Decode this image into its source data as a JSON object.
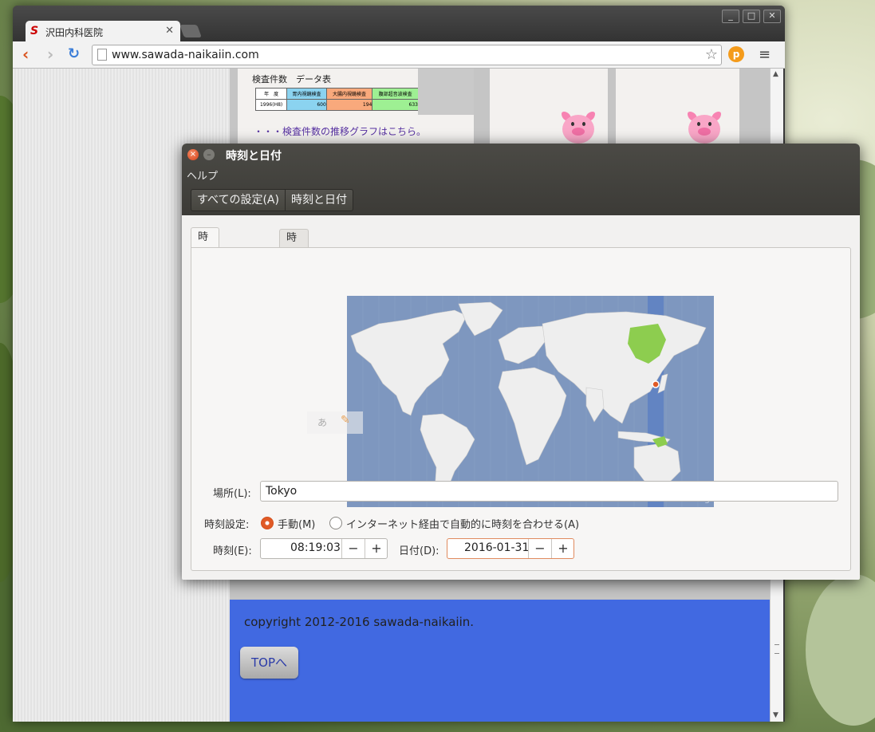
{
  "browser": {
    "tab_title": "沢田内科医院",
    "url": "www.sawada-naikaiin.com",
    "window_controls": [
      "minimize",
      "maximize",
      "close"
    ]
  },
  "website": {
    "table_title": "検査件数　データ表",
    "table_headers": [
      "年　度",
      "胃内視鏡検査",
      "大腸内視鏡検査",
      "腹部超音波検査"
    ],
    "table_row": [
      "1996(H8)",
      "600",
      "194",
      "633"
    ],
    "graph_link": "・・・検査件数の推移グラフはこちら。",
    "copyright": "copyright 2012-2016 sawada-naikaiin.",
    "top_button": "TOPへ"
  },
  "dialog": {
    "title": "時刻と日付",
    "menu_help": "ヘルプ",
    "breadcrumbs": [
      "すべての設定(A)",
      "時刻と日付"
    ],
    "tabs": [
      "時刻と日付(T)",
      "時計(C)"
    ],
    "map_credit": "Geonames.org",
    "location_label": "場所(L):",
    "location_value": "Tokyo",
    "time_setting_label": "時刻設定:",
    "manual_option": "手動(M)",
    "auto_option": "インターネット経由で自動的に時刻を合わせる(A)",
    "manual_selected": true,
    "time_label": "時刻(E):",
    "time_value": "08:19:03",
    "date_label": "日付(D):",
    "date_value": "2016-01-31",
    "minus": "−",
    "plus": "+"
  },
  "ime": {
    "char": "あ",
    "tool_icon": "wrench-icon"
  },
  "colors": {
    "footer_blue": "#4169e1",
    "highlight_green": "#8dcd4f",
    "accent_orange": "#e05a26"
  }
}
